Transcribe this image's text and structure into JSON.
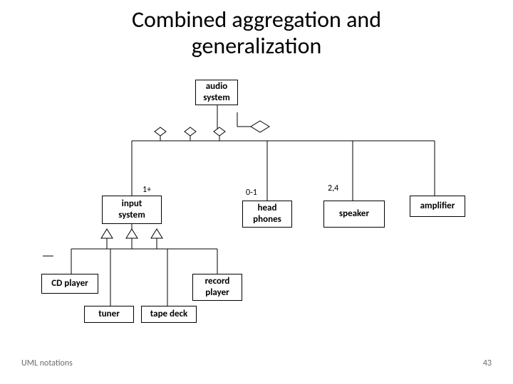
{
  "title_line1": "Combined aggregation and",
  "title_line2": "generalization",
  "footer_left": "UML notations",
  "footer_right": "43",
  "nodes": {
    "audio_system": "audio\nsystem",
    "input_system": "input\nsystem",
    "head_phones": "head\nphones",
    "speaker": "speaker",
    "amplifier": "amplifier",
    "cd_player": "CD player",
    "record_player": "record\nplayer",
    "tuner": "tuner",
    "tape_deck": "tape deck"
  },
  "multiplicities": {
    "input": "1+",
    "headphones": "0-1",
    "speaker": "2,4"
  }
}
